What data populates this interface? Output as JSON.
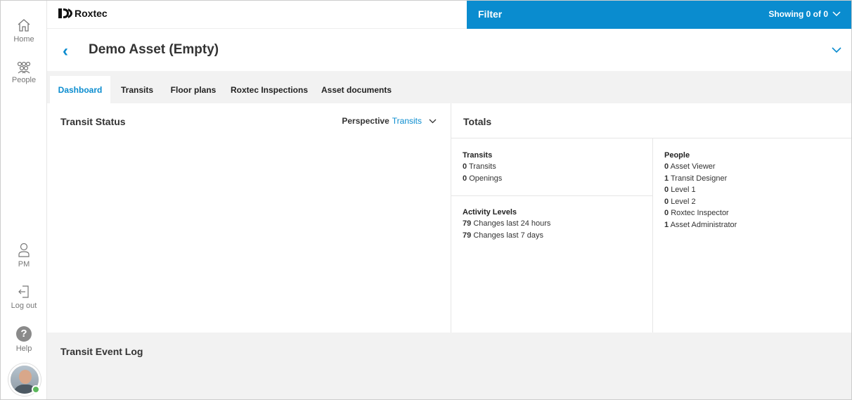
{
  "sidebar": {
    "home": {
      "label": "Home",
      "icon": "home-icon"
    },
    "people": {
      "label": "People",
      "icon": "people-icon"
    },
    "user": {
      "label": "PM",
      "icon": "user-icon"
    },
    "logout": {
      "label": "Log out",
      "icon": "logout-icon"
    },
    "help": {
      "label": "Help",
      "glyph": "?",
      "icon": "help-icon"
    },
    "avatar_status_color": "#5cb85c"
  },
  "header": {
    "brand": "Roxtec",
    "filter_title": "Filter",
    "filter_status": "Showing 0 of 0"
  },
  "page": {
    "title": "Demo Asset (Empty)",
    "back_glyph": "‹"
  },
  "tabs": [
    {
      "label": "Dashboard",
      "active": true
    },
    {
      "label": "Transits"
    },
    {
      "label": "Floor plans"
    },
    {
      "label": "Roxtec Inspections"
    },
    {
      "label": "Asset documents"
    }
  ],
  "transit_status": {
    "title": "Transit Status",
    "perspective_label": "Perspective",
    "perspective_value": "Transits"
  },
  "totals": {
    "title": "Totals",
    "transits": {
      "title": "Transits",
      "rows": [
        {
          "count": "0",
          "label": "Transits"
        },
        {
          "count": "0",
          "label": "Openings"
        }
      ]
    },
    "activity": {
      "title": "Activity Levels",
      "rows": [
        {
          "count": "79",
          "label": "Changes last 24 hours"
        },
        {
          "count": "79",
          "label": "Changes last 7 days"
        }
      ]
    },
    "people": {
      "title": "People",
      "rows": [
        {
          "count": "0",
          "label": "Asset Viewer"
        },
        {
          "count": "1",
          "label": "Transit Designer"
        },
        {
          "count": "0",
          "label": "Level 1"
        },
        {
          "count": "0",
          "label": "Level 2"
        },
        {
          "count": "0",
          "label": "Roxtec Inspector"
        },
        {
          "count": "1",
          "label": "Asset Administrator"
        }
      ]
    }
  },
  "event_log": {
    "title": "Transit Event Log"
  },
  "colors": {
    "accent": "#0a8ccf",
    "tabbar": "#f2f2f2"
  }
}
